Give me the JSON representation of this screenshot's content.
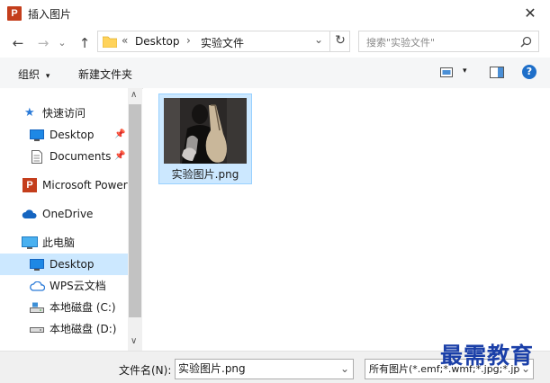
{
  "window": {
    "app_icon_letter": "P",
    "title": "插入图片",
    "close_glyph": "✕"
  },
  "nav": {
    "back": "←",
    "forward": "→",
    "recent": "⌄",
    "up": "↑"
  },
  "address": {
    "overflow": "«",
    "crumbs": [
      "Desktop",
      "实验文件"
    ],
    "separator": "›",
    "dropdown": "⌄",
    "refresh": "↻"
  },
  "search": {
    "placeholder": "搜索\"实验文件\"",
    "icon": "search-icon"
  },
  "toolbar": {
    "organize": "组织",
    "organize_arrow": "▾",
    "new_folder": "新建文件夹",
    "view_arrow": "▾",
    "help": "?"
  },
  "sidebar": {
    "scroll_up": "∧",
    "scroll_down": "∨",
    "items": [
      {
        "label": "快速访问",
        "icon": "star-icon"
      },
      {
        "label": "Desktop",
        "icon": "desktop-icon",
        "pinned": true
      },
      {
        "label": "Documents",
        "icon": "document-icon",
        "pinned": true
      },
      {
        "label": "Microsoft Power",
        "icon": "powerpoint-icon"
      },
      {
        "label": "OneDrive",
        "icon": "cloud-icon"
      },
      {
        "label": "此电脑",
        "icon": "computer-icon"
      },
      {
        "label": "Desktop",
        "icon": "desktop-icon",
        "selected": true
      },
      {
        "label": "WPS云文档",
        "icon": "cloud-outline-icon"
      },
      {
        "label": "本地磁盘 (C:)",
        "icon": "drive-icon"
      },
      {
        "label": "本地磁盘 (D:)",
        "icon": "drive-icon"
      }
    ]
  },
  "files": [
    {
      "name": "实验图片.png",
      "selected": true
    }
  ],
  "footer": {
    "filename_label": "文件名(N):",
    "filename_value": "实验图片.png",
    "filename_arrow": "⌄",
    "filter_value": "所有图片(*.emf;*.wmf;*.jpg;*.jp",
    "filter_arrow": "⌄"
  },
  "watermark": "最需教育"
}
